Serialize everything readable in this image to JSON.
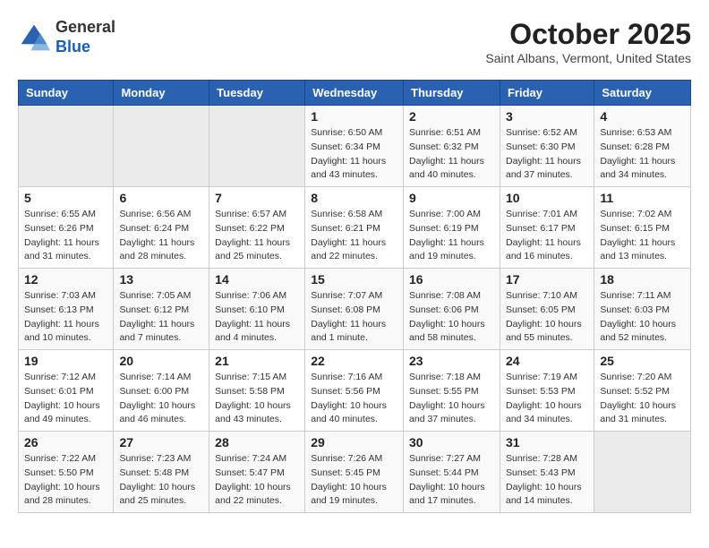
{
  "logo": {
    "general": "General",
    "blue": "Blue"
  },
  "title": "October 2025",
  "subtitle": "Saint Albans, Vermont, United States",
  "days_of_week": [
    "Sunday",
    "Monday",
    "Tuesday",
    "Wednesday",
    "Thursday",
    "Friday",
    "Saturday"
  ],
  "weeks": [
    [
      {
        "day": "",
        "info": ""
      },
      {
        "day": "",
        "info": ""
      },
      {
        "day": "",
        "info": ""
      },
      {
        "day": "1",
        "info": "Sunrise: 6:50 AM\nSunset: 6:34 PM\nDaylight: 11 hours\nand 43 minutes."
      },
      {
        "day": "2",
        "info": "Sunrise: 6:51 AM\nSunset: 6:32 PM\nDaylight: 11 hours\nand 40 minutes."
      },
      {
        "day": "3",
        "info": "Sunrise: 6:52 AM\nSunset: 6:30 PM\nDaylight: 11 hours\nand 37 minutes."
      },
      {
        "day": "4",
        "info": "Sunrise: 6:53 AM\nSunset: 6:28 PM\nDaylight: 11 hours\nand 34 minutes."
      }
    ],
    [
      {
        "day": "5",
        "info": "Sunrise: 6:55 AM\nSunset: 6:26 PM\nDaylight: 11 hours\nand 31 minutes."
      },
      {
        "day": "6",
        "info": "Sunrise: 6:56 AM\nSunset: 6:24 PM\nDaylight: 11 hours\nand 28 minutes."
      },
      {
        "day": "7",
        "info": "Sunrise: 6:57 AM\nSunset: 6:22 PM\nDaylight: 11 hours\nand 25 minutes."
      },
      {
        "day": "8",
        "info": "Sunrise: 6:58 AM\nSunset: 6:21 PM\nDaylight: 11 hours\nand 22 minutes."
      },
      {
        "day": "9",
        "info": "Sunrise: 7:00 AM\nSunset: 6:19 PM\nDaylight: 11 hours\nand 19 minutes."
      },
      {
        "day": "10",
        "info": "Sunrise: 7:01 AM\nSunset: 6:17 PM\nDaylight: 11 hours\nand 16 minutes."
      },
      {
        "day": "11",
        "info": "Sunrise: 7:02 AM\nSunset: 6:15 PM\nDaylight: 11 hours\nand 13 minutes."
      }
    ],
    [
      {
        "day": "12",
        "info": "Sunrise: 7:03 AM\nSunset: 6:13 PM\nDaylight: 11 hours\nand 10 minutes."
      },
      {
        "day": "13",
        "info": "Sunrise: 7:05 AM\nSunset: 6:12 PM\nDaylight: 11 hours\nand 7 minutes."
      },
      {
        "day": "14",
        "info": "Sunrise: 7:06 AM\nSunset: 6:10 PM\nDaylight: 11 hours\nand 4 minutes."
      },
      {
        "day": "15",
        "info": "Sunrise: 7:07 AM\nSunset: 6:08 PM\nDaylight: 11 hours\nand 1 minute."
      },
      {
        "day": "16",
        "info": "Sunrise: 7:08 AM\nSunset: 6:06 PM\nDaylight: 10 hours\nand 58 minutes."
      },
      {
        "day": "17",
        "info": "Sunrise: 7:10 AM\nSunset: 6:05 PM\nDaylight: 10 hours\nand 55 minutes."
      },
      {
        "day": "18",
        "info": "Sunrise: 7:11 AM\nSunset: 6:03 PM\nDaylight: 10 hours\nand 52 minutes."
      }
    ],
    [
      {
        "day": "19",
        "info": "Sunrise: 7:12 AM\nSunset: 6:01 PM\nDaylight: 10 hours\nand 49 minutes."
      },
      {
        "day": "20",
        "info": "Sunrise: 7:14 AM\nSunset: 6:00 PM\nDaylight: 10 hours\nand 46 minutes."
      },
      {
        "day": "21",
        "info": "Sunrise: 7:15 AM\nSunset: 5:58 PM\nDaylight: 10 hours\nand 43 minutes."
      },
      {
        "day": "22",
        "info": "Sunrise: 7:16 AM\nSunset: 5:56 PM\nDaylight: 10 hours\nand 40 minutes."
      },
      {
        "day": "23",
        "info": "Sunrise: 7:18 AM\nSunset: 5:55 PM\nDaylight: 10 hours\nand 37 minutes."
      },
      {
        "day": "24",
        "info": "Sunrise: 7:19 AM\nSunset: 5:53 PM\nDaylight: 10 hours\nand 34 minutes."
      },
      {
        "day": "25",
        "info": "Sunrise: 7:20 AM\nSunset: 5:52 PM\nDaylight: 10 hours\nand 31 minutes."
      }
    ],
    [
      {
        "day": "26",
        "info": "Sunrise: 7:22 AM\nSunset: 5:50 PM\nDaylight: 10 hours\nand 28 minutes."
      },
      {
        "day": "27",
        "info": "Sunrise: 7:23 AM\nSunset: 5:48 PM\nDaylight: 10 hours\nand 25 minutes."
      },
      {
        "day": "28",
        "info": "Sunrise: 7:24 AM\nSunset: 5:47 PM\nDaylight: 10 hours\nand 22 minutes."
      },
      {
        "day": "29",
        "info": "Sunrise: 7:26 AM\nSunset: 5:45 PM\nDaylight: 10 hours\nand 19 minutes."
      },
      {
        "day": "30",
        "info": "Sunrise: 7:27 AM\nSunset: 5:44 PM\nDaylight: 10 hours\nand 17 minutes."
      },
      {
        "day": "31",
        "info": "Sunrise: 7:28 AM\nSunset: 5:43 PM\nDaylight: 10 hours\nand 14 minutes."
      },
      {
        "day": "",
        "info": ""
      }
    ]
  ]
}
